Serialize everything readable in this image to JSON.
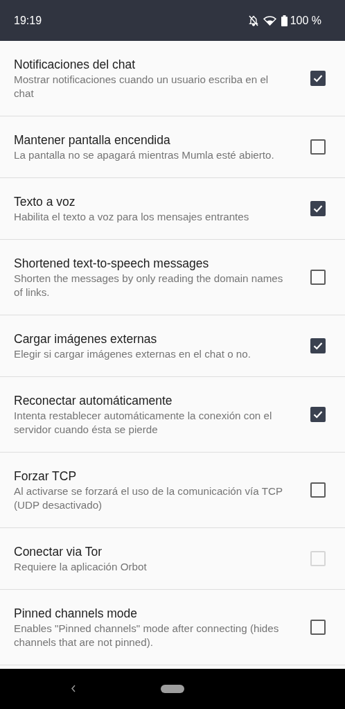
{
  "status_bar": {
    "time": "19:19",
    "battery": "100 %"
  },
  "settings": [
    {
      "title": "Notificaciones del chat",
      "summary": "Mostrar notificaciones cuando un usuario escriba en el chat",
      "checked": true,
      "disabled": false
    },
    {
      "title": "Mantener pantalla encendida",
      "summary": "La pantalla no se apagará mientras Mumla esté abierto.",
      "checked": false,
      "disabled": false
    },
    {
      "title": "Texto a voz",
      "summary": "Habilita el texto a voz para los mensajes entrantes",
      "checked": true,
      "disabled": false
    },
    {
      "title": "Shortened text-to-speech messages",
      "summary": "Shorten the messages by only reading the domain names of links.",
      "checked": false,
      "disabled": false
    },
    {
      "title": "Cargar imágenes externas",
      "summary": "Elegir si cargar imágenes externas en el chat o no.",
      "checked": true,
      "disabled": false
    },
    {
      "title": "Reconectar automáticamente",
      "summary": "Intenta restablecer automáticamente la conexión con el servidor cuando ésta se pierde",
      "checked": true,
      "disabled": false
    },
    {
      "title": "Forzar TCP",
      "summary": "Al activarse se forzará el uso de la comunicación vía TCP (UDP desactivado)",
      "checked": false,
      "disabled": false
    },
    {
      "title": "Conectar via Tor",
      "summary": "Requiere la aplicación Orbot",
      "checked": false,
      "disabled": true
    },
    {
      "title": "Pinned channels mode",
      "summary": "Enables \"Pinned channels\" mode after connecting (hides channels that are not pinned).",
      "checked": false,
      "disabled": false
    }
  ]
}
